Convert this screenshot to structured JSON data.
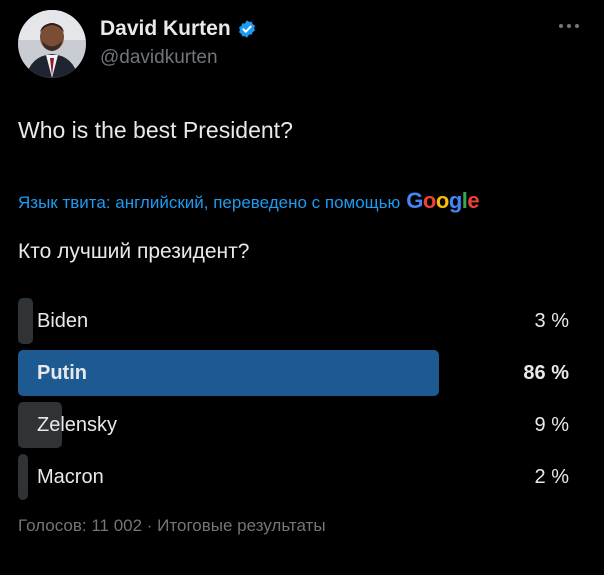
{
  "author": {
    "display_name": "David Kurten",
    "handle": "@davidkurten",
    "verified": true,
    "avatar_icon": "profile-photo",
    "verified_icon": "verified-badge-icon",
    "more_icon": "more-options-icon"
  },
  "tweet": {
    "text": "Who is the best President?",
    "translation_label": "Язык твита: английский, переведено с помощью",
    "translation_provider": "Google",
    "translated_text": "Кто лучший президент?"
  },
  "poll": {
    "options": [
      {
        "label": "Biden",
        "percent_text": "3 %",
        "value": 3,
        "winner": false
      },
      {
        "label": "Putin",
        "percent_text": "86 %",
        "value": 86,
        "winner": true
      },
      {
        "label": "Zelensky",
        "percent_text": "9 %",
        "value": 9,
        "winner": false
      },
      {
        "label": "Macron",
        "percent_text": "2 %",
        "value": 2,
        "winner": false
      }
    ],
    "summary": "Голосов: 11 002 · Итоговые результаты"
  },
  "colors": {
    "background": "#000000",
    "text": "#e7e9ea",
    "secondary": "#71767b",
    "link": "#1d9bf0",
    "winner_bar": "#1d5a92",
    "bar": "#2f3336"
  }
}
